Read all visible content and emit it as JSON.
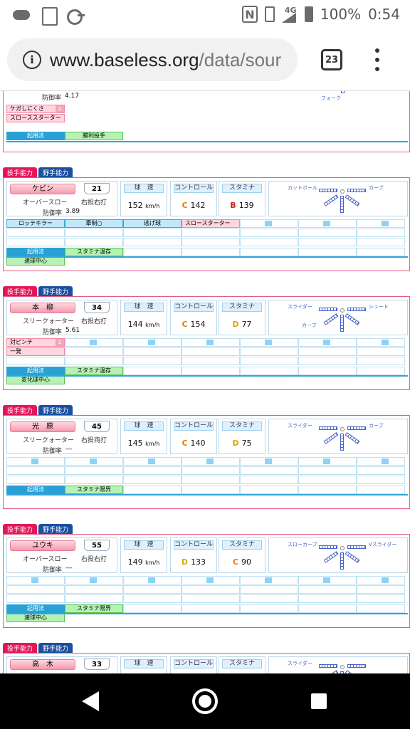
{
  "status": {
    "network": "4G",
    "battery": "100%",
    "time": "0:54"
  },
  "browser": {
    "url_main": "www.baseless.org",
    "url_path": "/data/sour",
    "tab_count": "23"
  },
  "tabs": {
    "pitch": "投手能力",
    "field": "野手能力"
  },
  "labels": {
    "era": "防御率",
    "speed": "球　速",
    "control": "コントロール",
    "stamina": "スタミナ",
    "unit": "km/h",
    "kiyo": "起用法"
  },
  "partial": {
    "era_value": "4.17",
    "pitch": "フォーク",
    "skills": [
      {
        "name": "ケガしにくさ",
        "level": "2"
      },
      {
        "name": "スローススターター",
        "level": ""
      }
    ],
    "usage": "勝利投手"
  },
  "cards": [
    {
      "name": "ケビン",
      "number": "21",
      "form": "オーバースロー",
      "hand": "右投右打",
      "era": "3.89",
      "speed": "152",
      "control_rank": "C",
      "control": "142",
      "stamina_rank": "B",
      "stamina": "139",
      "pitches": [
        "カットボール",
        "カーブ"
      ],
      "skills": [
        {
          "name": "ロッテキラー",
          "kind": "blue"
        },
        {
          "name": "牽制○",
          "kind": "blue"
        },
        {
          "name": "逃げ球",
          "kind": "blue"
        },
        {
          "name": "スロースターター",
          "kind": "pink"
        }
      ],
      "usage": [
        "スタミナ温存"
      ],
      "role": "速球中心"
    },
    {
      "name": "本　柳",
      "number": "34",
      "form": "スリークォーター",
      "hand": "右投右打",
      "era": "5.61",
      "speed": "144",
      "control_rank": "C",
      "control": "154",
      "stamina_rank": "D",
      "stamina": "77",
      "pitches": [
        "スライダー",
        "シュート",
        "カーブ"
      ],
      "skills": [
        {
          "name": "対ピンチ",
          "level": "2"
        },
        {
          "name": "一発",
          "level": ""
        }
      ],
      "usage": [
        "スタミナ温存"
      ],
      "role": "変化球中心"
    },
    {
      "name": "光　原",
      "number": "45",
      "form": "スリークォーター",
      "hand": "右投両打",
      "era": "---",
      "speed": "145",
      "control_rank": "C",
      "control": "140",
      "stamina_rank": "D",
      "stamina": "75",
      "pitches": [
        "スライダー",
        "カーブ"
      ],
      "skills": [],
      "usage": [
        "スタミナ限界"
      ],
      "role": ""
    },
    {
      "name": "ユウキ",
      "number": "55",
      "form": "オーバースロー",
      "hand": "右投右打",
      "era": "---",
      "speed": "149",
      "control_rank": "D",
      "control": "133",
      "stamina_rank": "C",
      "stamina": "90",
      "pitches": [
        "スローカーブ",
        "Vスライダー"
      ],
      "skills": [],
      "usage": [
        "スタミナ限界"
      ],
      "role": "速球中心"
    },
    {
      "name": "高　木",
      "number": "33",
      "pitches": [
        "スライダー"
      ]
    }
  ],
  "colors": {
    "rank_C": "#e07a12",
    "rank_B": "#d81b1b",
    "rank_D": "#e0a800",
    "accent_pink": "#e2175a",
    "accent_blue": "#1b4fa0"
  }
}
